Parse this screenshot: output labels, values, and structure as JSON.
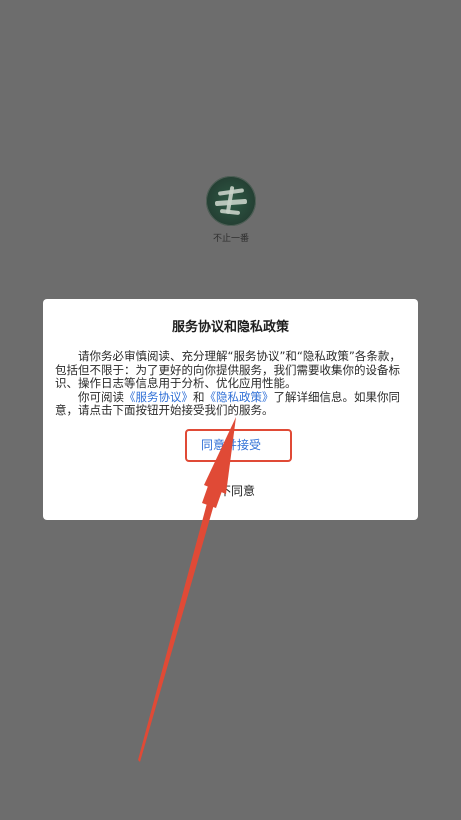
{
  "app": {
    "name": "不止一番"
  },
  "dialog": {
    "title": "服务协议和隐私政策",
    "paragraph1": "请你务必审慎阅读、充分理解“服务协议”和“隐私政策”各条款，包括但不限于：为了更好的向你提供服务，我们需要收集你的设备标识、操作日志等信息用于分析、优化应用性能。",
    "paragraph2_prefix": "你可阅读",
    "service_link": "《服务协议》",
    "paragraph2_and": "和",
    "privacy_link": "《隐私政策》",
    "paragraph2_suffix": "了解详细信息。如果你同意，请点击下面按钮开始接受我们的服务。",
    "agree_label": "同意并接受",
    "disagree_label": "暂不同意"
  },
  "colors": {
    "overlay": "#6d6d6d",
    "link": "#2f6fd6",
    "annotation": "#e04a36"
  }
}
